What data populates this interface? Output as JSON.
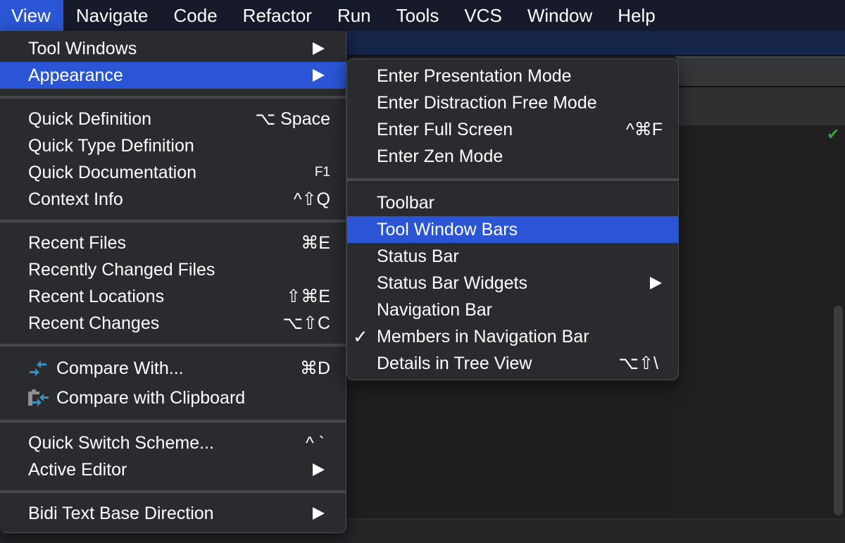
{
  "menubar": {
    "items": [
      {
        "label": "View",
        "active": true
      },
      {
        "label": "Navigate"
      },
      {
        "label": "Code"
      },
      {
        "label": "Refactor"
      },
      {
        "label": "Run"
      },
      {
        "label": "Tools"
      },
      {
        "label": "VCS"
      },
      {
        "label": "Window"
      },
      {
        "label": "Help"
      }
    ]
  },
  "view_menu": {
    "items": {
      "tool_windows": {
        "label": "Tool Windows",
        "submenu": true
      },
      "appearance": {
        "label": "Appearance",
        "submenu": true,
        "highlighted": true
      },
      "quick_definition": {
        "label": "Quick Definition",
        "shortcut": "⌥ Space"
      },
      "quick_type_definition": {
        "label": "Quick Type Definition"
      },
      "quick_documentation": {
        "label": "Quick Documentation",
        "shortcut": "F1"
      },
      "context_info": {
        "label": "Context Info",
        "shortcut": "^⇧Q"
      },
      "recent_files": {
        "label": "Recent Files",
        "shortcut": "⌘E"
      },
      "recently_changed_files": {
        "label": "Recently Changed Files"
      },
      "recent_locations": {
        "label": "Recent Locations",
        "shortcut": "⇧⌘E"
      },
      "recent_changes": {
        "label": "Recent Changes",
        "shortcut": "⌥⇧C"
      },
      "compare_with": {
        "label": "Compare With...",
        "shortcut": "⌘D",
        "icon": "compare-icon"
      },
      "compare_with_clipboard": {
        "label": "Compare with Clipboard",
        "icon": "compare-clipboard-icon"
      },
      "quick_switch_scheme": {
        "label": "Quick Switch Scheme...",
        "shortcut": "^ `"
      },
      "active_editor": {
        "label": "Active Editor",
        "submenu": true
      },
      "bidi_text_base_direction": {
        "label": "Bidi Text Base Direction",
        "submenu": true
      }
    }
  },
  "appearance_submenu": {
    "items": {
      "enter_presentation_mode": {
        "label": "Enter Presentation Mode"
      },
      "enter_distraction_free_mode": {
        "label": "Enter Distraction Free Mode"
      },
      "enter_full_screen": {
        "label": "Enter Full Screen",
        "shortcut": "^⌘F"
      },
      "enter_zen_mode": {
        "label": "Enter Zen Mode"
      },
      "toolbar": {
        "label": "Toolbar"
      },
      "tool_window_bars": {
        "label": "Tool Window Bars",
        "highlighted": true
      },
      "status_bar": {
        "label": "Status Bar"
      },
      "status_bar_widgets": {
        "label": "Status Bar Widgets",
        "submenu": true
      },
      "navigation_bar": {
        "label": "Navigation Bar"
      },
      "members_in_navigation_bar": {
        "label": "Members in Navigation Bar",
        "checked": true,
        "check_glyph": "✓"
      },
      "details_in_tree_view": {
        "label": "Details in Tree View",
        "shortcut": "⌥⇧\\"
      }
    }
  },
  "editor": {
    "status_check_glyph": "✔"
  },
  "colors": {
    "accent": "#2a56d6",
    "menu_bg": "#2a2b2e",
    "menubar_bg": "#161a2b",
    "status_ok": "#3d9c3f",
    "icon_blue": "#3592c4"
  }
}
